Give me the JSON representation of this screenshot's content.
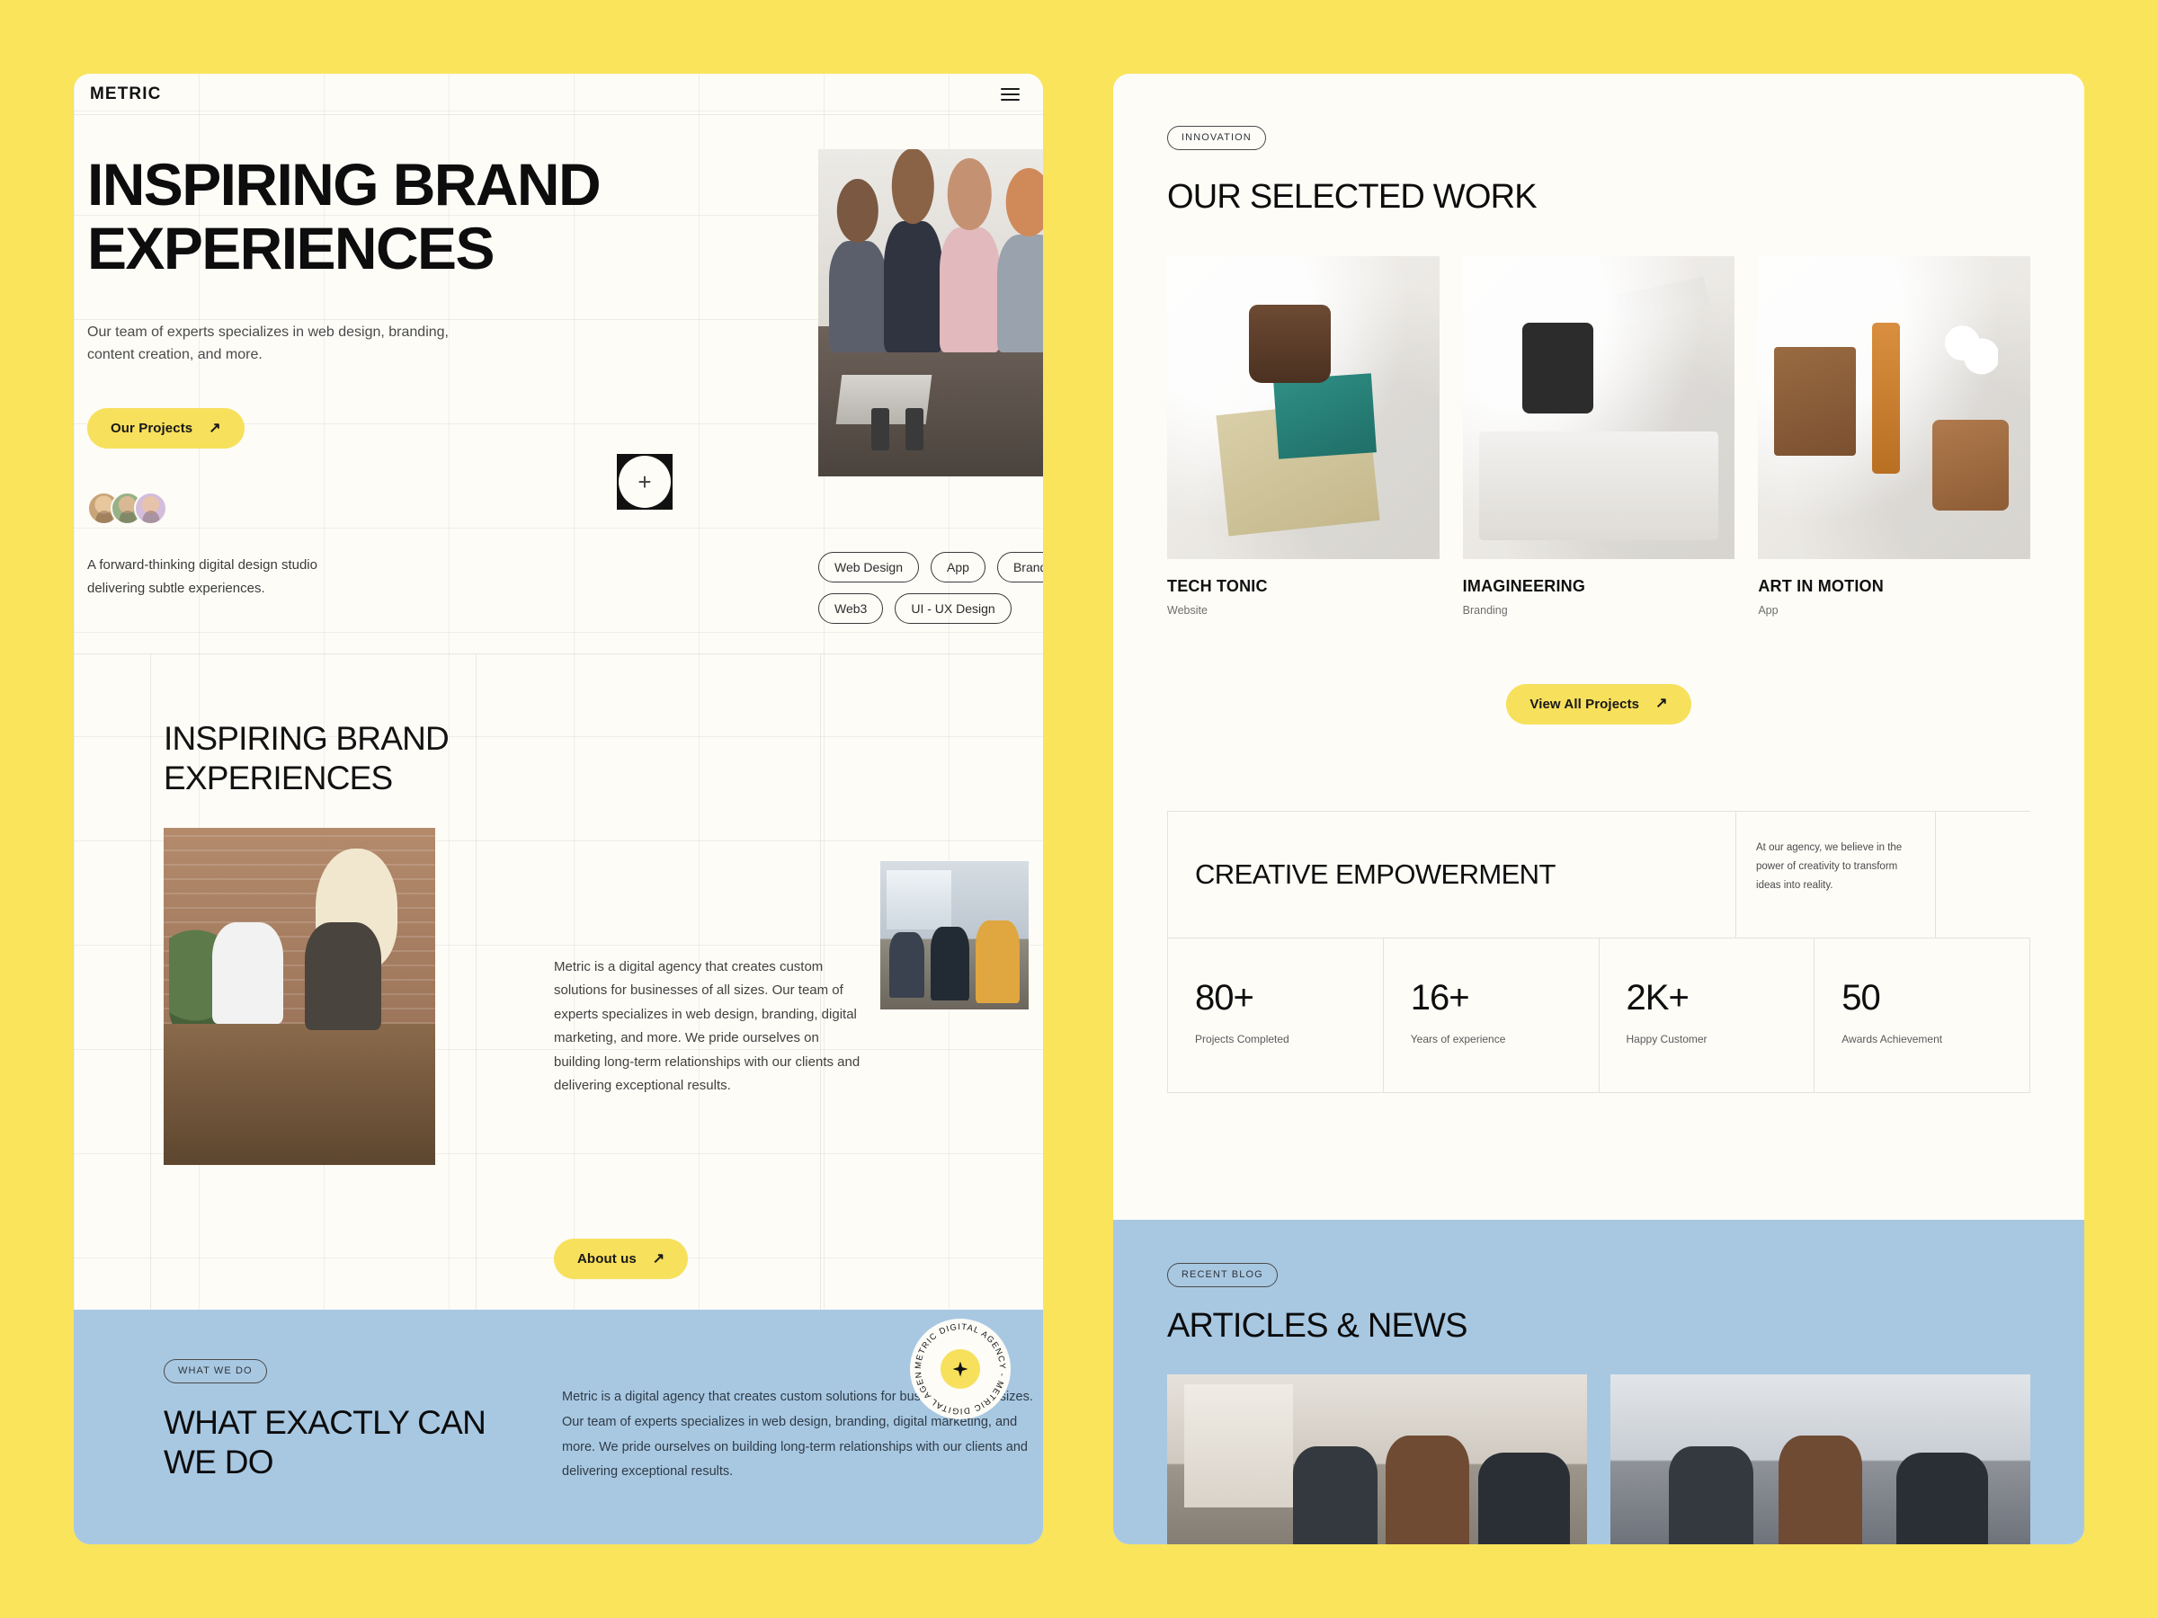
{
  "theme": {
    "page_background": "#f9e45b",
    "panel_background": "#fdfcf7",
    "accent_yellow": "#f7e05c",
    "accent_blue": "#a8c8e2",
    "ink": "#111111"
  },
  "left_panel": {
    "header": {
      "brand": "METRIC",
      "menu_icon": "hamburger-menu-icon"
    },
    "hero": {
      "title": "INSPIRING BRAND EXPERIENCES",
      "subtitle": "Our team of experts specializes in web design, branding, content creation, and more.",
      "cta_label": "Our Projects",
      "cta_arrow": "↗",
      "note": "A forward-thinking digital design studio delivering subtle experiences.",
      "plus_icon": "plus-icon",
      "avatar_count": 3,
      "tags": [
        "Web Design",
        "App",
        "Branding",
        "Web3",
        "UI - UX Design"
      ]
    },
    "about": {
      "title": "INSPIRING BRAND EXPERIENCES",
      "paragraph": "Metric is a digital agency that creates custom solutions for businesses of all sizes. Our team of experts specializes in web design, branding, digital marketing, and more. We pride ourselves on building long-term relationships with our clients and delivering exceptional results.",
      "cta_label": "About us",
      "cta_arrow": "↗"
    },
    "seal": {
      "text": "METRIC DIGITAL AGENCY - METRIC DIGITAL AGENCY - ",
      "icon": "sparkle-star-icon"
    },
    "what_we_do": {
      "chip": "WHAT WE DO",
      "title": "WHAT EXACTLY CAN WE DO",
      "paragraph": "Metric is a digital agency that creates custom solutions for businesses of all sizes. Our team of experts specializes in web design, branding, digital marketing, and more. We pride ourselves on building long-term relationships with our clients and delivering exceptional results."
    }
  },
  "right_panel": {
    "work": {
      "chip": "INNOVATION",
      "title": "OUR SELECTED WORK",
      "projects": [
        {
          "name": "TECH TONIC",
          "category": "Website"
        },
        {
          "name": "IMAGINEERING",
          "category": "Branding"
        },
        {
          "name": "ART IN MOTION",
          "category": "App"
        }
      ],
      "cta_label": "View All Projects",
      "cta_arrow": "↗"
    },
    "empowerment": {
      "heading": "CREATIVE EMPOWERMENT",
      "blurb": "At our agency, we believe in the power of creativity to transform ideas into reality.",
      "stats": [
        {
          "value": "80+",
          "label": "Projects Completed"
        },
        {
          "value": "16+",
          "label": "Years of experience"
        },
        {
          "value": "2K+",
          "label": "Happy Customer"
        },
        {
          "value": "50",
          "label": "Awards Achievement"
        }
      ]
    },
    "blog": {
      "chip": "RECENT BLOG",
      "title": "ARTICLES & NEWS"
    }
  }
}
